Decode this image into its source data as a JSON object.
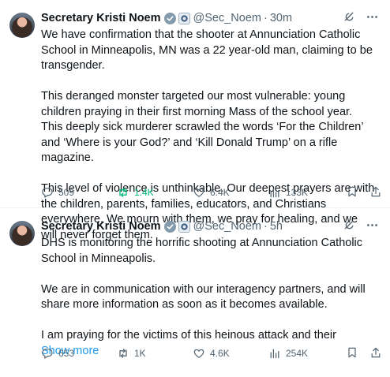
{
  "tweets": [
    {
      "author": "Secretary Kristi Noem",
      "handle": "@Sec_Noem",
      "separator": "·",
      "time": "30m",
      "paragraphs": [
        "We have confirmation that the shooter at Annunciation Catholic School in Minneapolis, MN was a 22 year-old man, claiming to be transgender.",
        "This deranged monster targeted our most vulnerable: young children praying in their first morning Mass of the school year. This deeply sick murderer scrawled the words ‘For the Children’ and ‘Where is your God?’ and ‘Kill Donald Trump’ on a rifle magazine.",
        "This level of violence is unthinkable. Our deepest prayers are with the children, parents, families, educators, and Christians everywhere. We mourn with them, we pray for healing, and we will never forget them."
      ],
      "show_more": "",
      "replies": "509",
      "reposts": "1.4K",
      "likes": "6.4K",
      "views": "133K",
      "reposted_color": "#00ba7c"
    },
    {
      "author": "Secretary Kristi Noem",
      "handle": "@Sec_Noem",
      "separator": "·",
      "time": "5h",
      "paragraphs": [
        "DHS is monitoring the horrific shooting at Annunciation Catholic School in Minneapolis.",
        "We are in communication with our interagency partners, and will share more information as soon as it becomes available.",
        "I am praying for the victims of this heinous attack and their"
      ],
      "show_more": "Show more",
      "replies": "653",
      "reposts": "1K",
      "likes": "4.6K",
      "views": "254K"
    }
  ],
  "icons": {
    "verified": "gray-checkmark-badge-icon",
    "affiliation": "government-seal-icon",
    "grok": "grok-icon",
    "more": "more-dots-icon",
    "reply": "reply-bubble-icon",
    "repost": "repost-arrows-icon",
    "like": "heart-icon",
    "views": "views-bar-chart-icon",
    "bookmark": "bookmark-icon",
    "share": "share-upload-icon"
  },
  "colors": {
    "text": "#0f1419",
    "secondary": "#536471",
    "link": "#1d9bf0",
    "badge": "#829aab"
  }
}
